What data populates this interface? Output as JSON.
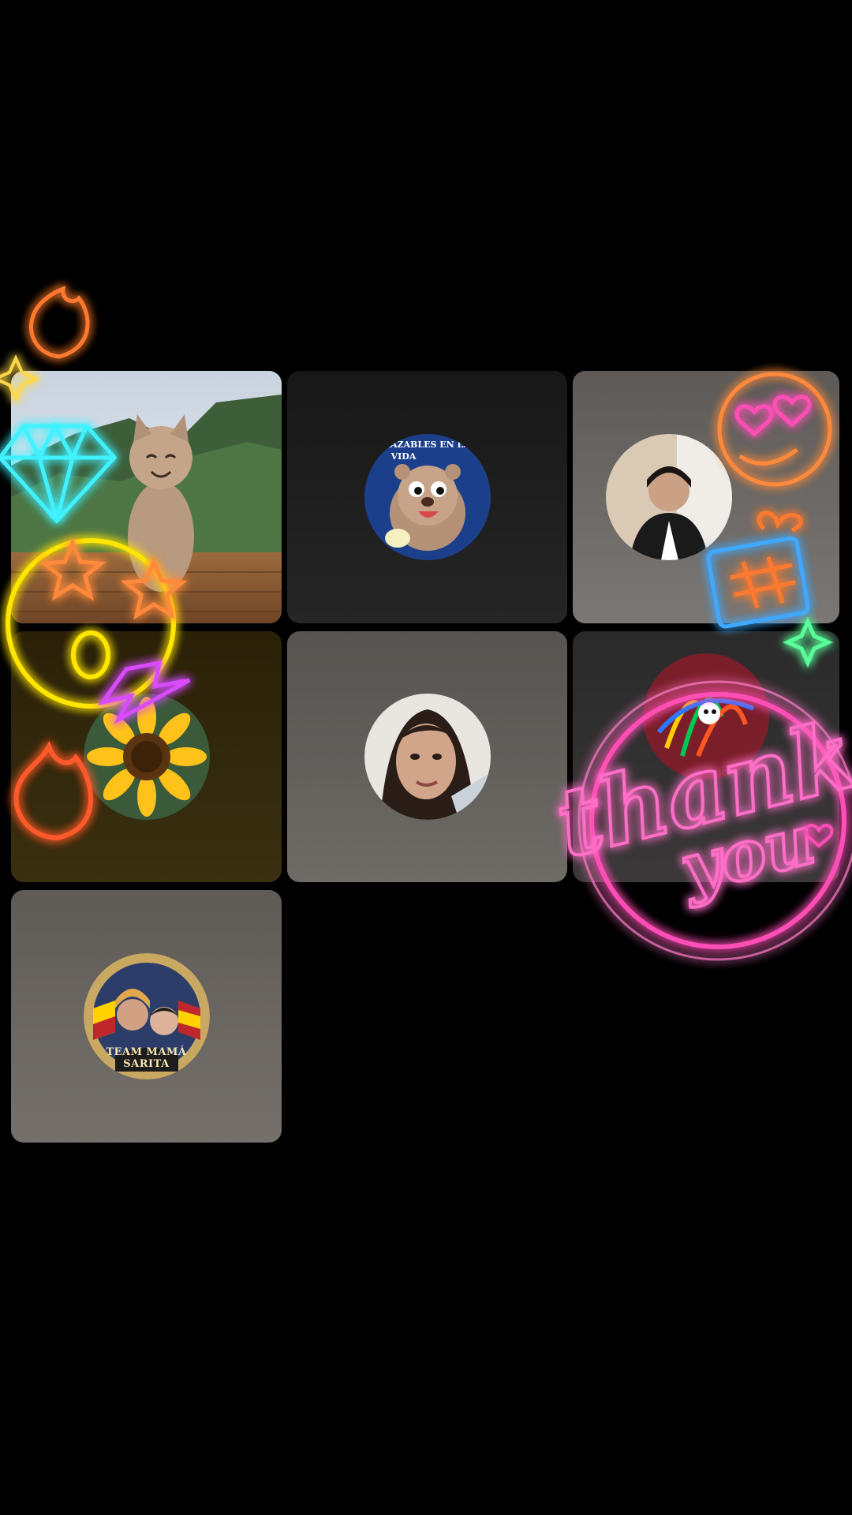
{
  "tiles": [
    {
      "id": "mountain-cat",
      "kind": "video"
    },
    {
      "id": "cartoon-beaver",
      "avatar_caption_line1": "LAZABLES EN LA",
      "avatar_caption_line2": "VIDA"
    },
    {
      "id": "woman-profile-1"
    },
    {
      "id": "sunflower"
    },
    {
      "id": "woman-selfie"
    },
    {
      "id": "colorful-avatar"
    },
    {
      "id": "team-mama-sarita",
      "badge_text": "TEAM MAMÁ SARITA"
    }
  ],
  "effects": {
    "thank_you_line1": "thank",
    "thank_you_line2": "you",
    "colors": {
      "pink": "#ff4fb6",
      "yellow": "#ffe600",
      "cyan": "#3ff2ff",
      "orange": "#ff7a2f",
      "magenta": "#d84cff",
      "green": "#58ff9a"
    }
  },
  "icons": [
    "fire-neon-icon",
    "diamond-neon-icon",
    "star-eyes-emoji-icon",
    "lightning-neon-icon",
    "heart-eyes-emoji-icon",
    "gift-neon-icon",
    "sparkle-neon-icon",
    "thank-you-neon-sticker"
  ]
}
